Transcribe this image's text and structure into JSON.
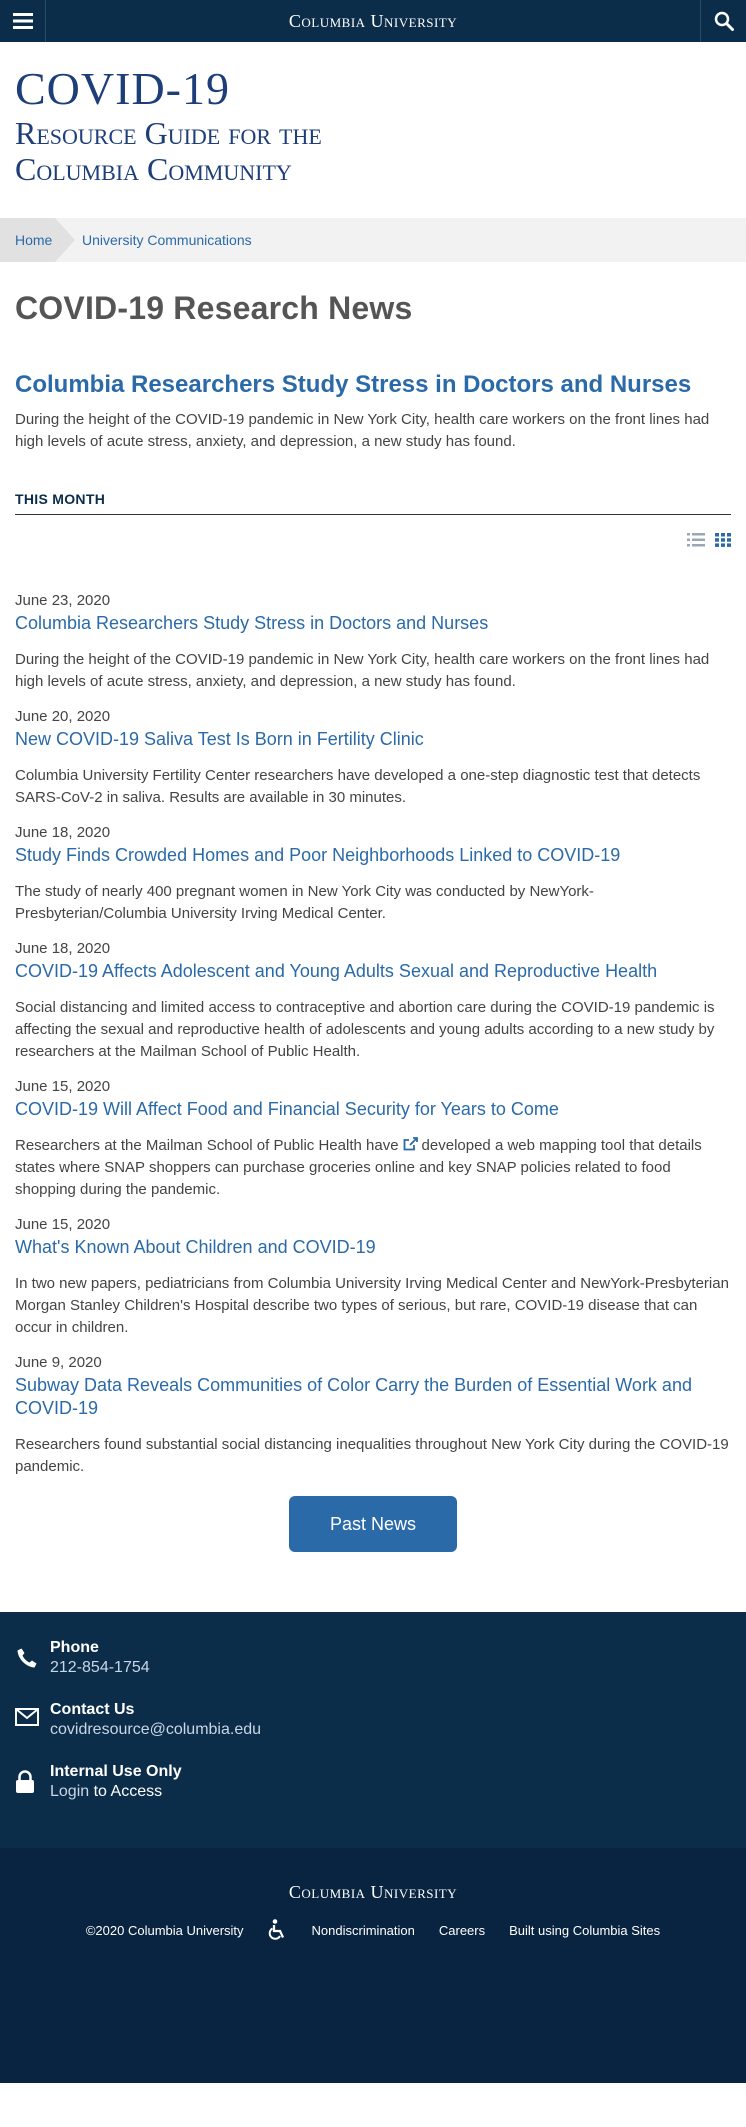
{
  "topbar": {
    "brand": "Columbia University"
  },
  "header": {
    "title": "COVID-19",
    "subtitle_line1": "Resource Guide for the",
    "subtitle_line2": "Columbia Community"
  },
  "breadcrumb": {
    "home": "Home",
    "current": "University Communications"
  },
  "page_title": "COVID-19 Research News",
  "feature": {
    "title": "Columbia Researchers Study Stress in Doctors and Nurses",
    "summary": "During the height of the COVID-19 pandemic in New York City, health care workers on the front lines had high levels of acute stress, anxiety, and depression, a new study has found."
  },
  "section_heading": "THIS MONTH",
  "news": [
    {
      "date": "June 23, 2020",
      "title": "Columbia Researchers Study Stress in Doctors and Nurses",
      "summary": "During the height of the COVID-19 pandemic in New York City, health care workers on the front lines had high levels of acute stress, anxiety, and depression, a new study has found."
    },
    {
      "date": "June 20, 2020",
      "title": "New COVID-19 Saliva Test Is Born in Fertility Clinic",
      "summary": "Columbia University Fertility Center researchers have developed a one-step diagnostic test that detects SARS-CoV-2 in saliva. Results are available in 30 minutes."
    },
    {
      "date": "June 18, 2020",
      "title": "Study Finds Crowded Homes and Poor Neighborhoods Linked to COVID-19",
      "summary": "The study of nearly 400 pregnant women in New York City was conducted by NewYork-Presbyterian/Columbia University Irving Medical Center."
    },
    {
      "date": "June 18, 2020",
      "title": "COVID-19 Affects Adolescent and Young Adults Sexual and Reproductive Health",
      "summary": "Social distancing and limited access to contraceptive and abortion care during the COVID-19 pandemic is affecting the sexual and reproductive health of adolescents and young adults according to a new study by researchers at the Mailman School of Public Health."
    },
    {
      "date": "June 15, 2020",
      "title": "COVID-19 Will Affect Food and Financial Security for Years to Come",
      "summary_before": "Researchers at the Mailman School of Public Health have",
      "summary_link": "developed a web mapping tool",
      "summary_after": "that details states where SNAP shoppers can purchase groceries online and key SNAP policies related to food shopping during the pandemic."
    },
    {
      "date": "June 15, 2020",
      "title": "What's Known About Children and COVID-19",
      "summary": "In two new papers, pediatricians from Columbia University Irving Medical Center and NewYork-Presbyterian Morgan Stanley Children's Hospital describe two types of serious, but rare, COVID-19 disease that can occur in children."
    },
    {
      "date": "June 9, 2020",
      "title": "Subway Data Reveals Communities of Color Carry the Burden of Essential Work and COVID-19",
      "summary": "Researchers found substantial social distancing inequalities throughout New York City during the COVID-19 pandemic."
    }
  ],
  "past_news_button": "Past News",
  "contact": {
    "phone_label": "Phone",
    "phone_value": "212-854-1754",
    "contact_label": "Contact Us",
    "contact_value": "covidresource@columbia.edu",
    "internal_label": "Internal Use Only",
    "login_link": "Login",
    "login_after": "to Access"
  },
  "footer": {
    "brand": "Columbia University",
    "copyright": "©2020 Columbia University",
    "nondiscrimination": "Nondiscrimination",
    "careers": "Careers",
    "built": "Built using Columbia Sites"
  },
  "icons": [
    "menu-icon",
    "search-icon",
    "list-view-icon",
    "grid-view-icon",
    "external-link-icon",
    "phone-icon",
    "mail-icon",
    "lock-icon",
    "accessibility-icon"
  ],
  "colors": {
    "navy": "#0c2d4a",
    "link_blue": "#2b6aa8",
    "title_blue": "#1e3e7a"
  }
}
